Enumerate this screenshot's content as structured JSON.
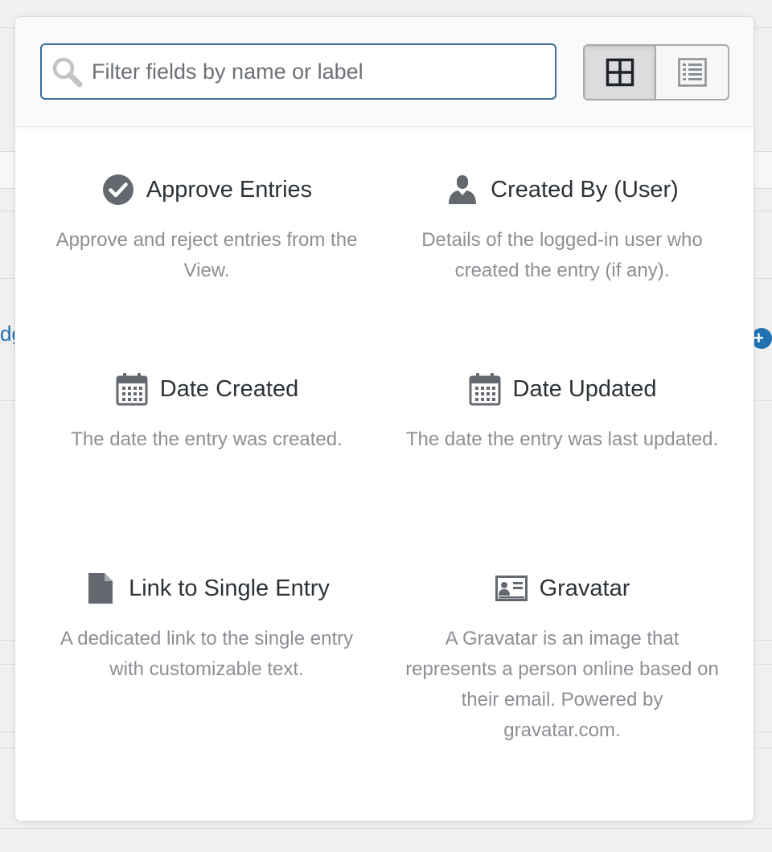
{
  "search": {
    "placeholder": "Filter fields by name or label",
    "value": ""
  },
  "view_toggle": {
    "active": "grid",
    "options": [
      {
        "name": "grid",
        "icon": "grid-icon"
      },
      {
        "name": "list",
        "icon": "list-icon"
      }
    ]
  },
  "background": {
    "partial_link_text": "dg"
  },
  "fields": [
    {
      "title": "Approve Entries",
      "description": "Approve and reject entries from the View.",
      "icon": "check-circle-icon"
    },
    {
      "title": "Created By (User)",
      "description": "Details of the logged-in user who created the entry (if any).",
      "icon": "user-icon"
    },
    {
      "title": "Date Created",
      "description": "The date the entry was created.",
      "icon": "calendar-icon"
    },
    {
      "title": "Date Updated",
      "description": "The date the entry was last updated.",
      "icon": "calendar-icon"
    },
    {
      "title": "Link to Single Entry",
      "description": "A dedicated link to the single entry with customizable text.",
      "icon": "document-icon"
    },
    {
      "title": "Gravatar",
      "description": "A Gravatar is an image that represents a person online based on their email. Powered by gravatar.com.",
      "icon": "id-card-icon"
    }
  ],
  "colors": {
    "accent": "#3d6ea0",
    "title_text": "#2c3338",
    "desc_text": "#8c8f94",
    "icon": "#646970"
  }
}
